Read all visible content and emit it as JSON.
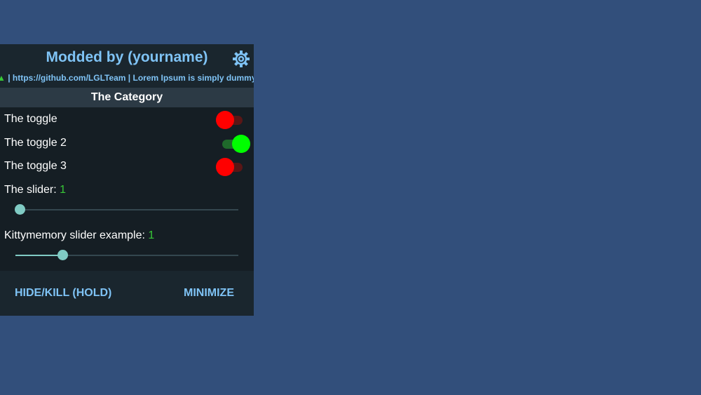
{
  "menu": {
    "title": "Modded by (yourname)",
    "marquee_prefix": "▲",
    "marquee_text": " | https://github.com/LGLTeam | Lorem Ipsum is simply dummy t",
    "category": "The Category",
    "toggles": [
      {
        "label": "The toggle",
        "state": "off"
      },
      {
        "label": "The toggle 2",
        "state": "on"
      },
      {
        "label": "The toggle 3",
        "state": "off"
      }
    ],
    "sliders": [
      {
        "label": "The slider: ",
        "value": "1",
        "fraction": 0.01
      },
      {
        "label": "Kittymemory slider example: ",
        "value": "1",
        "fraction": 0.2
      }
    ],
    "footer": {
      "hide_label": "HIDE/KILL (HOLD)",
      "minimize_label": "MINIMIZE"
    }
  },
  "colors": {
    "background": "#324f7b",
    "accent": "#7fc3f5",
    "toggle_off": "#ff0000",
    "toggle_on": "#00ff00",
    "slider": "#80cbc4",
    "value": "#37c837"
  },
  "icons": {
    "settings": "gear-icon"
  }
}
